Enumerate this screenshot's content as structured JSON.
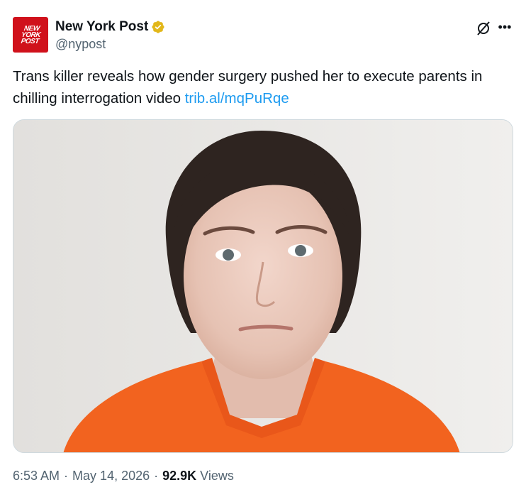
{
  "author": {
    "display_name": "New York Post",
    "handle": "@nypost",
    "avatar_text": [
      "NEW",
      "YORK",
      "POST"
    ],
    "verified_badge_color": "#e2b719"
  },
  "tweet": {
    "text": "Trans killer reveals how gender surgery pushed her to execute parents in chilling interrogation video ",
    "link_text": "trib.al/mqPuRqe",
    "link_color": "#1d9bf0"
  },
  "meta": {
    "time": "6:53 AM",
    "separator": "·",
    "date": "May 14, 2026",
    "views_count": "92.9K",
    "views_label": "Views"
  },
  "icons": {
    "grok": "grok-icon",
    "more": "more-icon",
    "verified": "verified-badge-icon"
  }
}
